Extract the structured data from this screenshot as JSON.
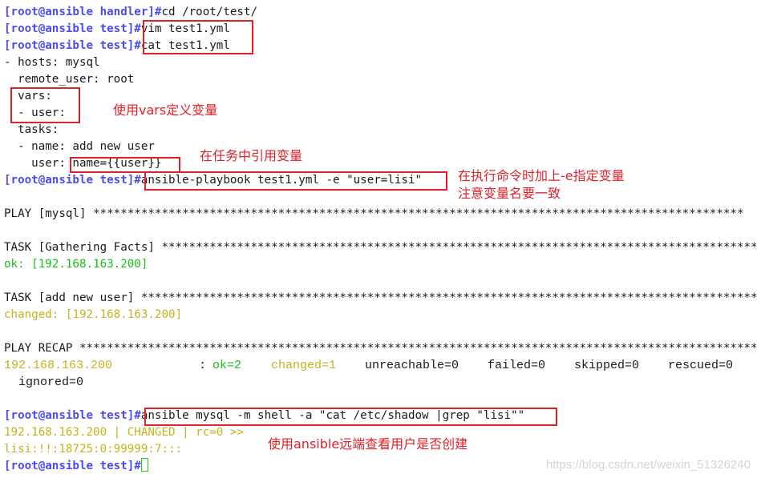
{
  "terminal": {
    "prompt_handler": "[root@ansible handler]#",
    "prompt_test": "[root@ansible test]#",
    "cmd_cd": "cd /root/test/",
    "cmd_vim": "vim test1.yml",
    "cmd_cat": "cat test1.yml",
    "yaml": [
      "- hosts: mysql",
      "  remote_user: root",
      "  vars:",
      "  - user:",
      "  tasks:",
      "  - name: add new user",
      "    user: "
    ],
    "yaml_user_value": "name={{user}}",
    "cmd_playbook": "ansible-playbook test1.yml -e \"user=lisi\"",
    "play_header": "PLAY [mysql] ***********************************************************************************************",
    "task1_header": "TASK [Gathering Facts] ****************************************************************************************",
    "task1_result": "ok: [192.168.163.200]",
    "task2_header": "TASK [add new user] *******************************************************************************************",
    "task2_result": "changed: [192.168.163.200]",
    "recap_header": "PLAY RECAP ***********************************************************************************************************",
    "recap": {
      "host": "192.168.163.200",
      "colon": ":",
      "ok": "ok=2",
      "changed": "changed=1",
      "unreachable": "unreachable=0",
      "failed": "failed=0",
      "skipped": "skipped=0",
      "rescued": "rescued=0",
      "ignored": "ignored=0"
    },
    "cmd_adhoc": "ansible mysql -m shell -a \"cat /etc/shadow |grep \"lisi\"\"",
    "adhoc_status": "192.168.163.200 | CHANGED | rc=0 >>",
    "adhoc_output": "lisi:!!:18725:0:99999:7:::"
  },
  "annotations": {
    "vars_note": "使用vars定义变量",
    "task_note": "在任务中引用变量",
    "cmd_note_1": "在执行命令时加上-e指定变量",
    "cmd_note_2": "注意变量名要一致",
    "adhoc_note": "使用ansible远端查看用户是否创建"
  },
  "watermark": "https://blog.csdn.net/weixin_51326240",
  "colors": {
    "prompt": "#4b4bf0",
    "ok": "#19c019",
    "changed": "#c3b41f",
    "annotation": "#e0202a"
  }
}
